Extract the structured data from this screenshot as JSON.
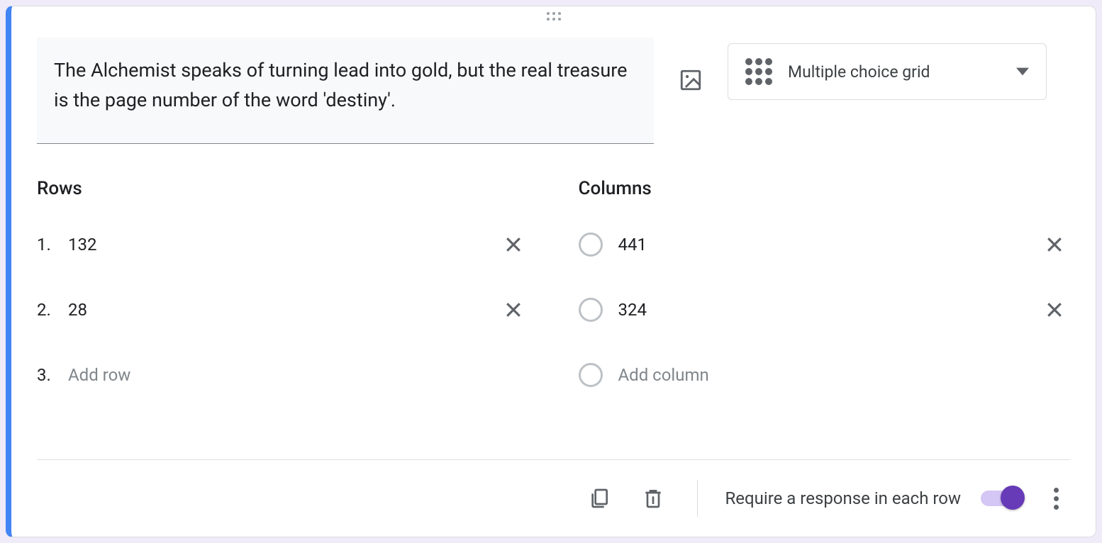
{
  "question": {
    "text": "The Alchemist speaks of turning lead into gold, but the real treasure is the page number of the word 'destiny'.",
    "type_label": "Multiple choice grid"
  },
  "rows": {
    "title": "Rows",
    "items": [
      {
        "num": "1.",
        "label": "132"
      },
      {
        "num": "2.",
        "label": "28"
      }
    ],
    "add_num": "3.",
    "add_label": "Add row"
  },
  "columns": {
    "title": "Columns",
    "items": [
      {
        "label": "441"
      },
      {
        "label": "324"
      }
    ],
    "add_label": "Add column"
  },
  "footer": {
    "require_label": "Require a response in each row",
    "require_on": true
  }
}
